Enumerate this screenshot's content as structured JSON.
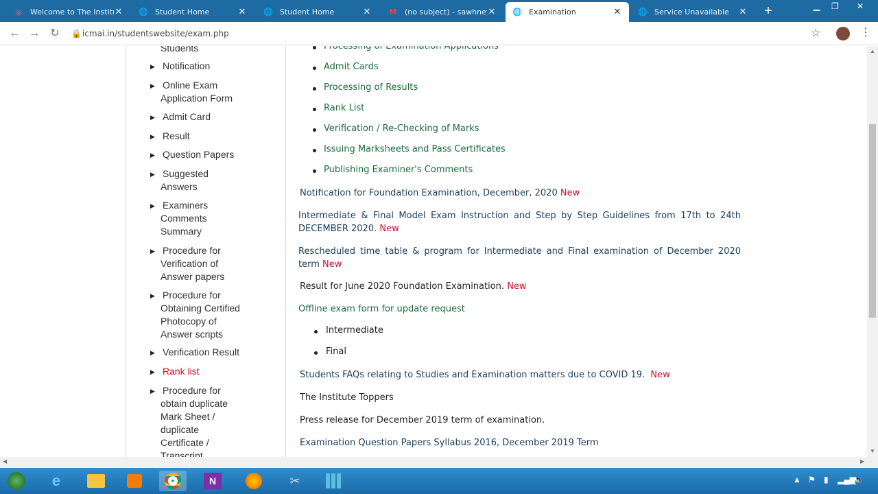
{
  "browser": {
    "tabs": [
      {
        "title": "Welcome to The Institut",
        "icon": "institute-favicon"
      },
      {
        "title": "Student Home",
        "icon": "globe-icon"
      },
      {
        "title": "Student Home",
        "icon": "globe-icon"
      },
      {
        "title": "(no subject) - sawhney.r",
        "icon": "gmail-icon"
      },
      {
        "title": "Examination",
        "icon": "globe-icon",
        "active": true
      },
      {
        "title": "Service Unavailable",
        "icon": "globe-icon"
      }
    ],
    "url": "icmai.in/studentswebsite/exam.php",
    "close_glyph": "✕",
    "newtab_glyph": "+"
  },
  "sidebar": {
    "items": [
      {
        "label": "Students"
      },
      {
        "label": "Notification"
      },
      {
        "label": "Online Exam Application Form"
      },
      {
        "label": "Admit Card"
      },
      {
        "label": "Result"
      },
      {
        "label": "Question Papers"
      },
      {
        "label": "Suggested Answers"
      },
      {
        "label": "Examiners Comments Summary"
      },
      {
        "label": "Procedure for Verification of Answer papers"
      },
      {
        "label": "Procedure for Obtaining Certified Photocopy of Answer scripts"
      },
      {
        "label": "Verification Result"
      },
      {
        "label": "Rank list"
      },
      {
        "label": "Procedure for obtain duplicate Mark Sheet / duplicate Certificate / Transcript"
      }
    ]
  },
  "main": {
    "process_list": [
      "Processing of Examination Applications",
      "Admit Cards",
      "Processing of Results",
      "Rank List",
      "Verification / Re-Checking of Marks",
      "Issuing Marksheets and Pass Certificates",
      "Publishing Examiner's Comments"
    ],
    "notices": {
      "foundation": "Notification for Foundation Examination, December, 2020",
      "model_exam": "Intermediate & Final Model Exam Instruction and Step by Step Guidelines from 17th to 24th DECEMBER 2020.",
      "rescheduled": "Rescheduled time table & program for Intermediate and Final examination of December 2020 term",
      "result_june": "Result for June 2020 Foundation Examination.",
      "offline_form": "Offline exam form for update request",
      "faqs": "Students FAQs relating to Studies and Examination matters due to COVID 19.",
      "toppers": "The Institute Toppers",
      "press_release": "Press release for December 2019 term of examination.",
      "question_papers": "Examination Question Papers Syllabus 2016, December 2019 Term"
    },
    "offline_list": [
      "Intermediate",
      "Final"
    ],
    "new_badge": "New"
  },
  "colors": {
    "link_green": "#1a6b3a",
    "link_blue": "#1a3d5c",
    "new_red": "#c8102e",
    "tab_strip": "#1e6aa3"
  }
}
